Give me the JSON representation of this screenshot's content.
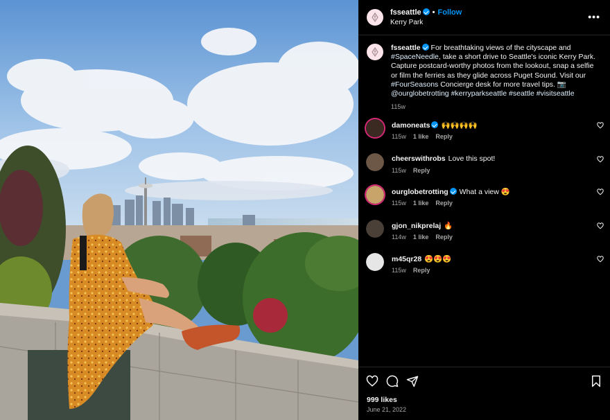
{
  "post": {
    "username": "fsseattle",
    "follow_label": "Follow",
    "separator": "•",
    "location": "Kerry Park",
    "more_label": "•••"
  },
  "caption": {
    "username": "fsseattle",
    "segments": [
      {
        "text": " For breathtaking views of the cityscape and ",
        "tag": false
      },
      {
        "text": "#SpaceNeedle",
        "tag": true
      },
      {
        "text": ", take a short drive to Seattle's iconic Kerry Park. Capture postcard-worthy photos from the lookout, snap a selfie or film the ferries as they glide across Puget Sound. Visit our ",
        "tag": false
      },
      {
        "text": "#FourSeasons",
        "tag": true
      },
      {
        "text": " Concierge desk for more travel tips. 📷 ",
        "tag": false
      },
      {
        "text": "@ourglobetrotting",
        "tag": true
      },
      {
        "text": " ",
        "tag": false
      },
      {
        "text": "#kerryparkseattle",
        "tag": true
      },
      {
        "text": " ",
        "tag": false
      },
      {
        "text": "#seattle",
        "tag": true
      },
      {
        "text": " ",
        "tag": false
      },
      {
        "text": "#visitseattle",
        "tag": true
      }
    ],
    "time": "115w"
  },
  "comments": [
    {
      "username": "damoneats",
      "verified": true,
      "text": "🙌🙌🙌🙌",
      "time": "115w",
      "likes": "1 like",
      "reply": "Reply",
      "ring": true,
      "avatar_color": "#3b2a22"
    },
    {
      "username": "cheerswithrobs",
      "verified": false,
      "text": "Love this spot!",
      "time": "115w",
      "likes": "",
      "reply": "Reply",
      "ring": false,
      "avatar_color": "#6d5848"
    },
    {
      "username": "ourglobetrotting",
      "verified": true,
      "text": "What a view 😍",
      "time": "115w",
      "likes": "1 like",
      "reply": "Reply",
      "ring": true,
      "avatar_color": "#c9a46a"
    },
    {
      "username": "gjon_nikprelaj",
      "verified": false,
      "text": "🔥",
      "time": "114w",
      "likes": "1 like",
      "reply": "Reply",
      "ring": false,
      "avatar_color": "#4a4038"
    },
    {
      "username": "m45qr28",
      "verified": false,
      "text": "😍😍😍",
      "time": "115w",
      "likes": "",
      "reply": "Reply",
      "ring": false,
      "avatar_color": "#e6e6e6"
    }
  ],
  "footer": {
    "likes": "999 likes",
    "date": "June 21, 2022"
  },
  "icons": {
    "like": "heart-icon",
    "comment": "comment-icon",
    "share": "share-icon",
    "save": "bookmark-icon",
    "more": "more-options-icon",
    "verified": "verified-badge-icon"
  },
  "colors": {
    "background": "#000000",
    "link_blue": "#0095f6",
    "muted": "#a8a8a8",
    "divider": "#262626",
    "story_ring": "#d62976"
  }
}
